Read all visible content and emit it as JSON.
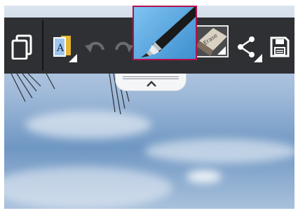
{
  "toolbar": {
    "eraser_label": "Erase"
  }
}
